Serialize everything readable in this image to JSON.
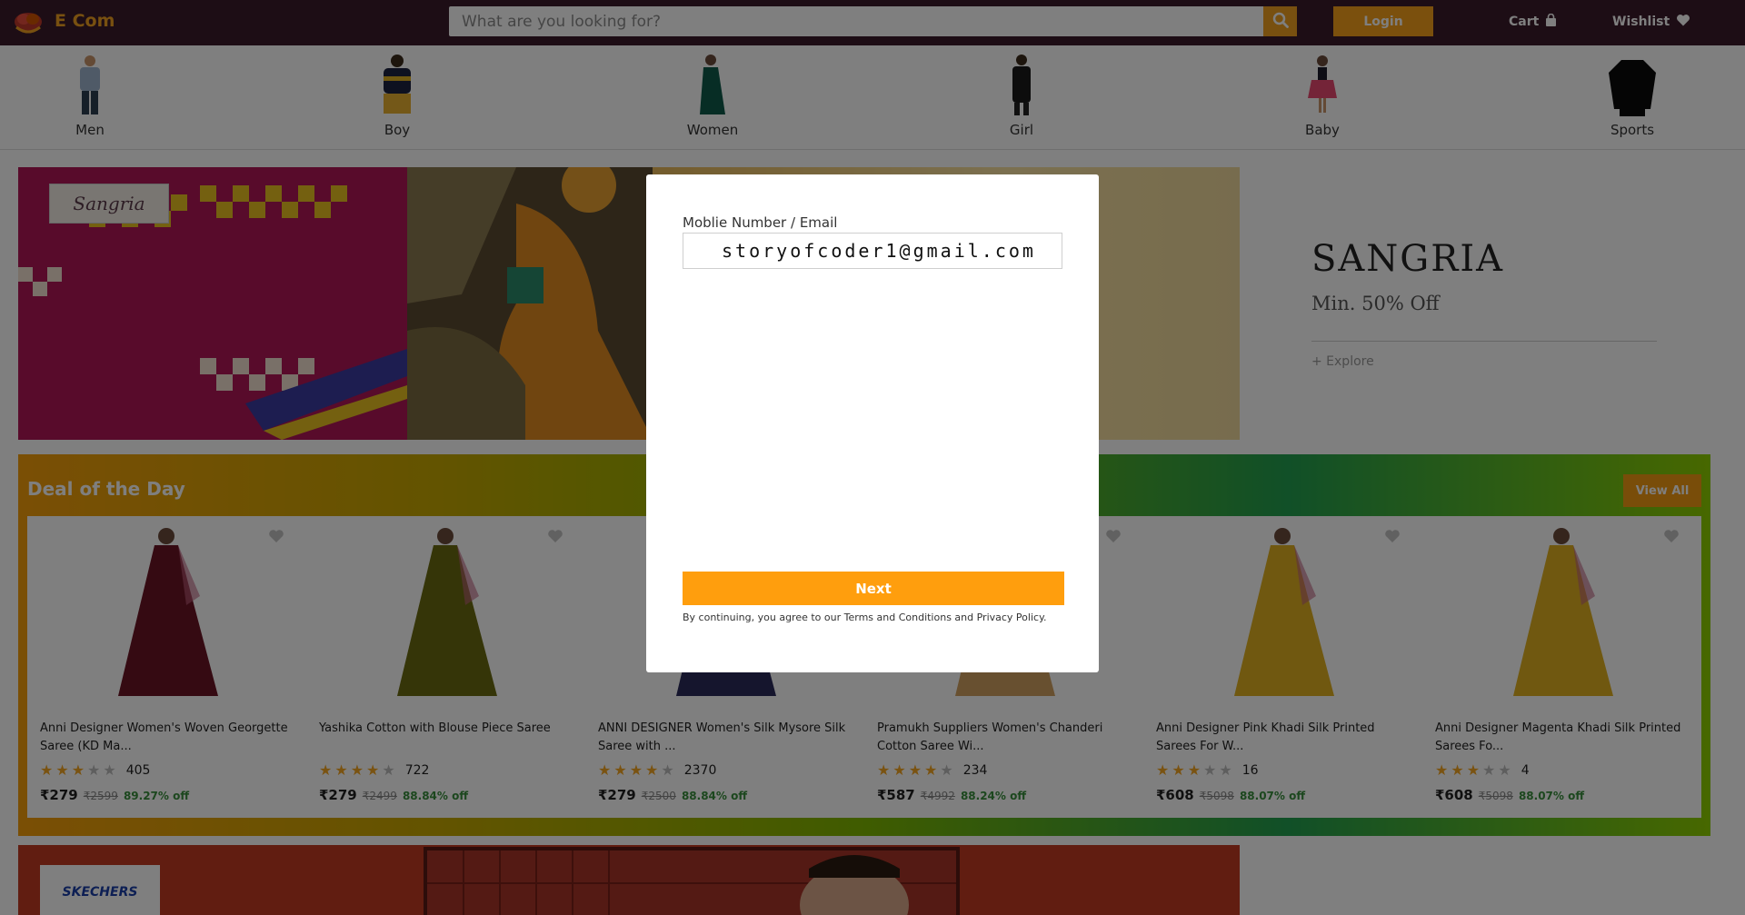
{
  "header": {
    "brand": "E Com",
    "search_placeholder": "What are you looking for?",
    "login_label": "Login",
    "cart_label": "Cart",
    "wishlist_label": "Wishlist"
  },
  "categories": [
    {
      "label": "Men"
    },
    {
      "label": "Boy"
    },
    {
      "label": "Women"
    },
    {
      "label": "Girl"
    },
    {
      "label": "Baby"
    },
    {
      "label": "Sports"
    }
  ],
  "banner": {
    "brand_logo": "Sangria",
    "title": "SANGRIA",
    "subtitle": "Min. 50% Off",
    "explore": "+ Explore"
  },
  "deal": {
    "title": "Deal of the Day",
    "view_all": "View All",
    "products": [
      {
        "title": "Anni Designer Women's Woven Georgette Saree (KD Ma...",
        "rating": 3,
        "rating_count": "405",
        "price": "₹279",
        "mrp": "₹2599",
        "discount": "89.27% off",
        "color": "#6b1424"
      },
      {
        "title": "Yashika Cotton with Blouse Piece Saree",
        "rating": 4,
        "rating_count": "722",
        "price": "₹279",
        "mrp": "₹2499",
        "discount": "88.84% off",
        "color": "#6b6a10"
      },
      {
        "title": "ANNI DESIGNER Women's Silk Mysore Silk Saree with ...",
        "rating": 4,
        "rating_count": "2370",
        "price": "₹279",
        "mrp": "₹2500",
        "discount": "88.84% off",
        "color": "#2a2a5a"
      },
      {
        "title": "Pramukh Suppliers Women's Chanderi Cotton Saree Wi...",
        "rating": 4,
        "rating_count": "234",
        "price": "₹587",
        "mrp": "₹4992",
        "discount": "88.24% off",
        "color": "#d0a060"
      },
      {
        "title": "Anni Designer Pink Khadi Silk Printed Sarees For W...",
        "rating": 3,
        "rating_count": "16",
        "price": "₹608",
        "mrp": "₹5098",
        "discount": "88.07% off",
        "color": "#e0b020"
      },
      {
        "title": "Anni Designer Magenta Khadi Silk Printed Sarees Fo...",
        "rating": 3,
        "rating_count": "4",
        "price": "₹608",
        "mrp": "₹5098",
        "discount": "88.07% off",
        "color": "#e0b020"
      }
    ]
  },
  "banner2": {
    "brand_logo": "SKECHERS"
  },
  "login_modal": {
    "field_label": "Moblie Number / Email",
    "field_value": "storyofcoder1@gmail.com",
    "next_label": "Next",
    "terms": "By continuing, you agree to our Terms and Conditions and Privacy Policy."
  },
  "colors": {
    "header_bg": "#3a1a2a",
    "accent": "#f7a01a",
    "brand": "#f0a020"
  },
  "icons": {
    "search": "search-icon",
    "cart": "shopping-bag-icon",
    "wishlist": "heart-icon",
    "logo": "rose-logo-icon",
    "product_wishlist": "heart-icon"
  }
}
